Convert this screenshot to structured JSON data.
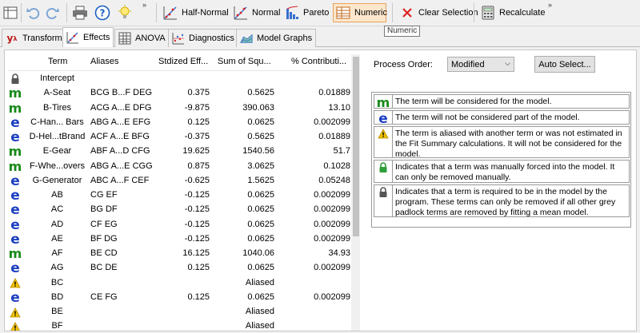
{
  "toolbar": {
    "half_normal": "Half-Normal",
    "normal": "Normal",
    "pareto": "Pareto",
    "numeric": "Numeric",
    "clear_selection": "Clear Selection",
    "recalculate": "Recalculate",
    "overflow": "»",
    "accent_color": "#e7a35b"
  },
  "tooltip": "Numeric",
  "tabs": [
    {
      "label": "Transform"
    },
    {
      "label": "Effects"
    },
    {
      "label": "ANOVA"
    },
    {
      "label": "Diagnostics"
    },
    {
      "label": "Model Graphs"
    }
  ],
  "table": {
    "headers": [
      "Term",
      "Aliases",
      "Stdized Eff...",
      "Sum of Squ...",
      "% Contributi..."
    ],
    "rows": [
      {
        "icon": "lock",
        "term": "Intercept",
        "aliases": "",
        "effect": "",
        "ss": "",
        "pct": ""
      },
      {
        "icon": "m",
        "term": "A-Seat",
        "aliases": "BCG B...F DEG",
        "effect": "0.375",
        "ss": "0.5625",
        "pct": "0.01889"
      },
      {
        "icon": "m",
        "term": "B-Tires",
        "aliases": "ACG A...E DFG",
        "effect": "-9.875",
        "ss": "390.063",
        "pct": "13.10"
      },
      {
        "icon": "e",
        "term": "C-Han... Bars",
        "aliases": "ABG A...E EFG",
        "effect": "0.125",
        "ss": "0.0625",
        "pct": "0.002099"
      },
      {
        "icon": "e",
        "term": "D-Hel...tBrand",
        "aliases": "ACF A...E BFG",
        "effect": "-0.375",
        "ss": "0.5625",
        "pct": "0.01889"
      },
      {
        "icon": "m",
        "term": "E-Gear",
        "aliases": "ABF A...D CFG",
        "effect": "19.625",
        "ss": "1540.56",
        "pct": "51.7"
      },
      {
        "icon": "m",
        "term": "F-Whe...overs",
        "aliases": "ABG A...E CGG",
        "effect": "0.875",
        "ss": "3.0625",
        "pct": "0.1028"
      },
      {
        "icon": "e",
        "term": "G-Generator",
        "aliases": "ABC A...F CEF",
        "effect": "-0.625",
        "ss": "1.5625",
        "pct": "0.05248"
      },
      {
        "icon": "e",
        "term": "AB",
        "aliases": "CG EF",
        "effect": "-0.125",
        "ss": "0.0625",
        "pct": "0.002099"
      },
      {
        "icon": "e",
        "term": "AC",
        "aliases": "BG DF",
        "effect": "-0.125",
        "ss": "0.0625",
        "pct": "0.002099"
      },
      {
        "icon": "e",
        "term": "AD",
        "aliases": "CF EG",
        "effect": "-0.125",
        "ss": "0.0625",
        "pct": "0.002099"
      },
      {
        "icon": "e",
        "term": "AE",
        "aliases": "BF DG",
        "effect": "-0.125",
        "ss": "0.0625",
        "pct": "0.002099"
      },
      {
        "icon": "m",
        "term": "AF",
        "aliases": "BE CD",
        "effect": "16.125",
        "ss": "1040.06",
        "pct": "34.93"
      },
      {
        "icon": "e",
        "term": "AG",
        "aliases": "BC DE",
        "effect": "0.125",
        "ss": "0.0625",
        "pct": "0.002099"
      },
      {
        "icon": "warn",
        "term": "BC",
        "aliases": "",
        "effect": "",
        "ss": "Aliased",
        "pct": ""
      },
      {
        "icon": "e",
        "term": "BD",
        "aliases": "CE FG",
        "effect": "0.125",
        "ss": "0.0625",
        "pct": "0.002099"
      },
      {
        "icon": "warn",
        "term": "BE",
        "aliases": "",
        "effect": "",
        "ss": "Aliased",
        "pct": ""
      },
      {
        "icon": "warn",
        "term": "BF",
        "aliases": "",
        "effect": "",
        "ss": "Aliased",
        "pct": ""
      }
    ]
  },
  "process_order": {
    "label": "Process Order:",
    "value": "Modified",
    "auto_select": "Auto Select..."
  },
  "legend": [
    {
      "icon": "m",
      "text": "The term will be considered for the model."
    },
    {
      "icon": "e",
      "text": "The term will not be considered part of the model."
    },
    {
      "icon": "warn",
      "text": "The term is aliased with another term or was not estimated in the Fit Summary calculations. It will not be considered for the model."
    },
    {
      "icon": "lock-green",
      "text": "Indicates that a term was manually forced into the model. It can only be removed manually."
    },
    {
      "icon": "lock",
      "text": "Indicates that a term is required to be in the model by the program. These terms can only be removed if all other grey padlock terms are removed by fitting a mean model."
    }
  ],
  "colors": {
    "model_term": "#178a18",
    "error_term": "#1b3fc0",
    "warning": "#f2c200",
    "forced_lock": "#2e9e3a",
    "required_lock": "#555555"
  }
}
